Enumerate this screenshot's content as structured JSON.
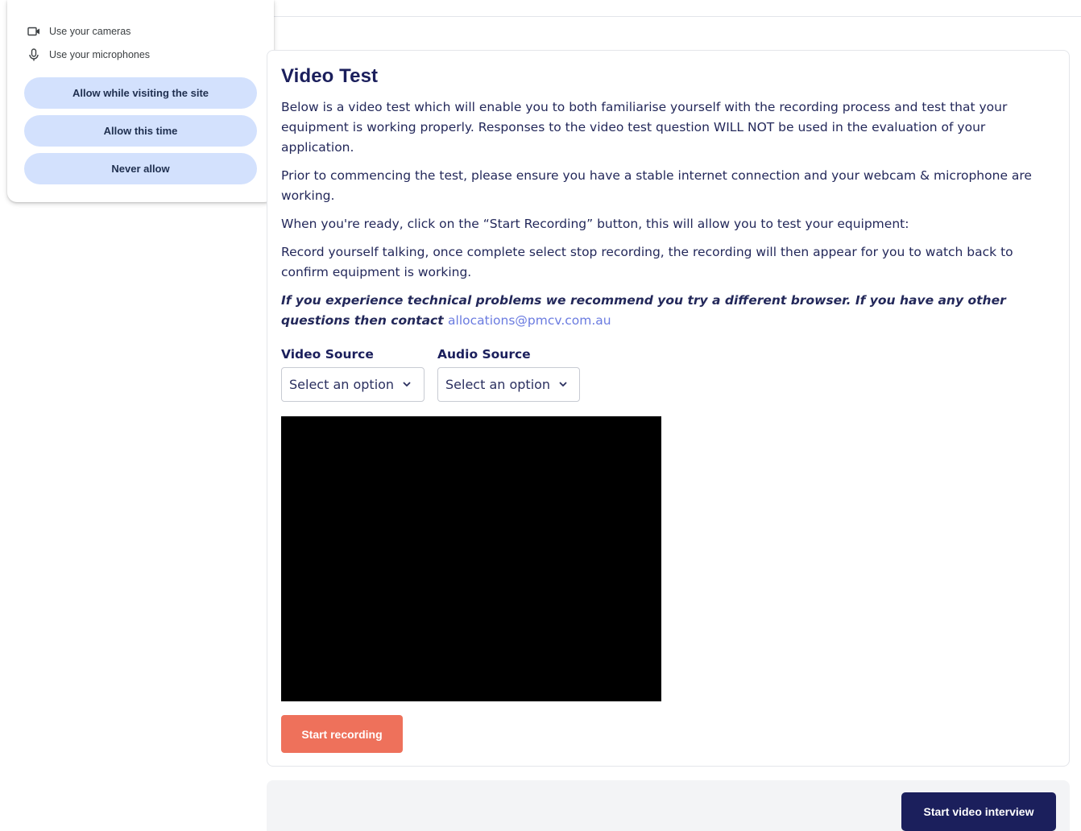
{
  "permission_popup": {
    "items": [
      {
        "icon": "camera-icon",
        "label": "Use your cameras"
      },
      {
        "icon": "microphone-icon",
        "label": "Use your microphones"
      }
    ],
    "buttons": {
      "allow_visiting": "Allow while visiting the site",
      "allow_once": "Allow this time",
      "never": "Never allow"
    }
  },
  "card": {
    "title": "Video Test",
    "paragraphs": [
      "Below is a video test which will enable you to both familiarise yourself with the recording process and test that your equipment is working properly. Responses to the video test question WILL NOT be used in the evaluation of your application.",
      "Prior to commencing the test, please ensure you have a stable internet connection and your webcam & microphone are working.",
      "When you're ready, click on the “Start Recording” button, this will allow you to test your equipment:",
      "Record yourself talking, once complete select stop recording, the recording will then appear for you to watch back to confirm equipment is working."
    ],
    "note_text": "If you experience technical problems we recommend you try a different browser. If you have any other questions then contact",
    "note_email": "allocations@pmcv.com.au",
    "video_source": {
      "label": "Video Source",
      "value": "Select an option"
    },
    "audio_source": {
      "label": "Audio Source",
      "value": "Select an option"
    },
    "record_button": "Start recording"
  },
  "footer": {
    "start_button": "Start video interview"
  },
  "colors": {
    "accent_navy": "#1b1f5c",
    "record_orange": "#ee715b",
    "popup_button": "#d3e1fd",
    "link": "#6a7be0"
  }
}
